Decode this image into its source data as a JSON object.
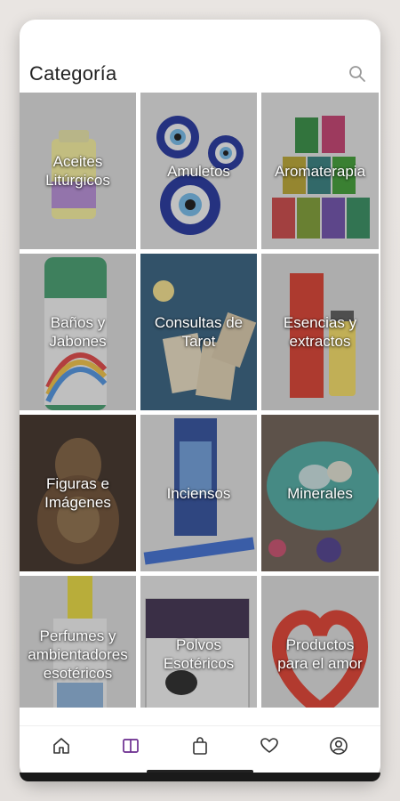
{
  "header": {
    "title": "Categoría"
  },
  "categories": [
    {
      "label": "Aceites\nLitúrgicos"
    },
    {
      "label": "Amuletos"
    },
    {
      "label": "Aromaterapia"
    },
    {
      "label": "Baños y\nJabones"
    },
    {
      "label": "Consultas de\nTarot"
    },
    {
      "label": "Esencias y\nextractos"
    },
    {
      "label": "Figuras e\nImágenes"
    },
    {
      "label": "Inciensos"
    },
    {
      "label": "Minerales"
    },
    {
      "label": "Perfumes y\nambientadores\nesotéricos"
    },
    {
      "label": "Polvos\nEsotéricos"
    },
    {
      "label": "Productos\npara el amor"
    }
  ],
  "nav": {
    "items": [
      {
        "icon": "home-icon"
      },
      {
        "icon": "catalog-icon",
        "active": true
      },
      {
        "icon": "shopping-bag-icon"
      },
      {
        "icon": "heart-icon"
      },
      {
        "icon": "profile-icon"
      }
    ]
  },
  "colors": {
    "active_nav": "#6b2d8f",
    "nav_icon": "#333333"
  }
}
